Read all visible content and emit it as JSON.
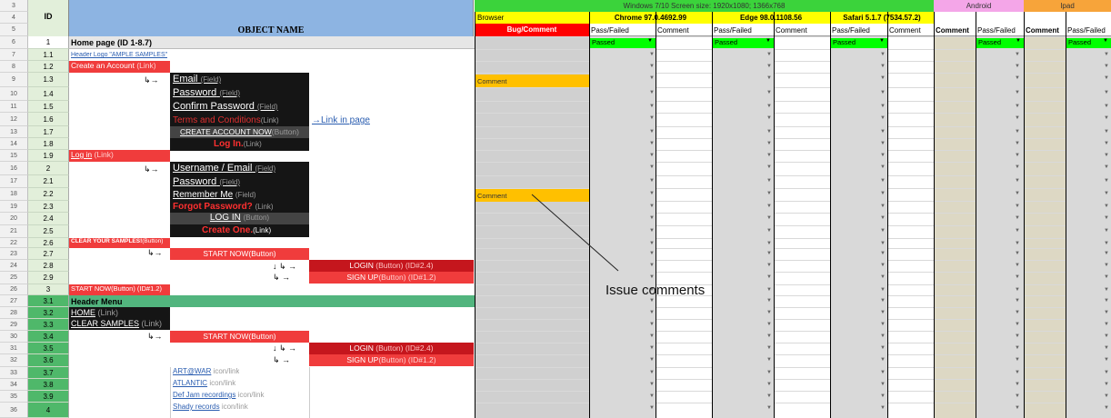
{
  "header": {
    "id_label": "ID",
    "object_name_label": "OBJECT NAME",
    "windows_banner": "Windows 7/10 Screen size: 1920x1080; 1366x768",
    "android_label": "Android",
    "ipad_label": "Ipad",
    "browser_label": "Browser",
    "bug_comment_label": "Bug/Comment",
    "chrome_label": "Chrome 97.0.4692.99",
    "edge_label": "Edge  98.0.1108.56",
    "safari_label": "Safari 5.1.7 (7534.57.2)",
    "pass_failed": "Pass/Failed",
    "comment": "Comment"
  },
  "row_numbers": [
    "3",
    "4",
    "5",
    "6",
    "7",
    "8",
    "9",
    "10",
    "11",
    "12",
    "13",
    "14",
    "15",
    "16",
    "17",
    "18",
    "19",
    "20",
    "21",
    "22",
    "23",
    "24",
    "25",
    "26",
    "27",
    "28",
    "29",
    "30",
    "31",
    "32",
    "33",
    "34",
    "35",
    "36"
  ],
  "ids": [
    "1",
    "1.1",
    "1.2",
    "1.3",
    "1.4",
    "1.5",
    "1.6",
    "1.7",
    "1.8",
    "1.9",
    "2",
    "2.1",
    "2.2",
    "2.3",
    "2.4",
    "2.5",
    "2.6",
    "2.7",
    "2.8",
    "2.9",
    "3",
    "3.1",
    "3.2",
    "3.3",
    "3.4",
    "3.5",
    "3.6",
    "3.7",
    "3.8",
    "3.9",
    "4"
  ],
  "objects": {
    "home_page": "Home page (ID 1-8.7)",
    "header_logo": "Header Logo \"AMPLE SAMPLES\"",
    "create_account": "Create an Account",
    "create_account_tag": "(Link)",
    "email": "Email",
    "email_tag": "(Field)",
    "password": "Password",
    "password_tag": "(Field)",
    "confirm_password": "Confirm Password",
    "confirm_tag": "(Field)",
    "terms": "Terms and Conditions",
    "terms_tag": "(Link)",
    "link_in_page": "→Link in page",
    "create_now": "CREATE ACCOUNT NOW",
    "create_now_tag": "(Button)",
    "login_in": "Log In.",
    "login_in_tag": "(Link)",
    "log_in": "Log in",
    "log_in_tag": "(Link)",
    "username": "Username / Email",
    "username_tag": "(Field)",
    "password2": "Password",
    "password2_tag": "(Field)",
    "remember_me": "Remember Me",
    "remember_tag": "(Field)",
    "forgot": "Forgot Password?",
    "forgot_tag": "(Link)",
    "login_btn": "LOG IN",
    "login_btn_tag": "(Button)",
    "create_one": "Create One.",
    "create_one_tag": "(Link)",
    "clear_samples": "CLEAR YOUR SAMPLES!",
    "clear_samples_tag": "(Button)",
    "start_now": "START NOW",
    "start_now_tag": "(Button)",
    "login_red": "LOGIN",
    "login_red_tag": "(Button)  (ID#2.4)",
    "signup_red": "SIGN UP",
    "signup_red_tag": "(Button)  (ID#1.2)",
    "start_now2": "START NOW",
    "start_now2_tag": "(Button) (ID#1.2)",
    "header_menu": "Header Menu",
    "home": "HOME",
    "home_tag": "(Link)",
    "clear": "CLEAR SAMPLES",
    "clear_tag": "(Link)",
    "start_now3": "START NOW",
    "start_now3_tag": "(Button)",
    "login3": "LOGIN",
    "login3_tag": "(Button)  (ID#2.4)",
    "signup3": "SIGN UP",
    "signup3_tag": "(Button)  (ID#1.2)",
    "artwar": "ART@WAR",
    "artwar_tag": "icon/link",
    "atlantic": "ATLANTIC",
    "atlantic_tag": "icon/link",
    "defjam": "Def Jam recordings",
    "defjam_tag": "icon/link",
    "shady": "Shady records",
    "shady_tag": "icon/link"
  },
  "test": {
    "passed": "Passed",
    "comment_cell": "Comment",
    "annotation": "Issue comments"
  },
  "colors": {
    "green_banner": "#3bd33b",
    "yellow": "#ffff00",
    "pink": "#f4a6e8",
    "orange": "#f7a43a",
    "passed_green": "#00ff00",
    "comment_orange": "#ffc000"
  }
}
